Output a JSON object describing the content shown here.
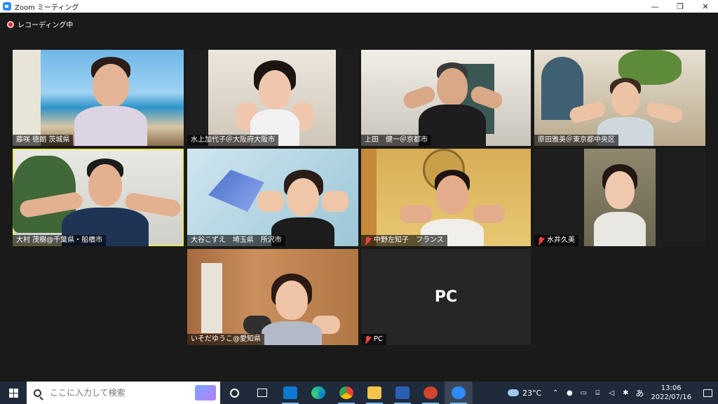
{
  "window": {
    "title": "Zoom ミーティング",
    "minimize": "—",
    "restore": "❐",
    "close": "✕"
  },
  "recording": {
    "label": "レコーディング中"
  },
  "tiles": [
    {
      "name": "藤咲 徳朗 茨城県",
      "muted": false,
      "active": false
    },
    {
      "name": "水上加代子＠大阪府大阪市",
      "muted": false,
      "active": false
    },
    {
      "name": "上田　健一＠京都市",
      "muted": false,
      "active": false
    },
    {
      "name": "原田雅美＠東京都中央区",
      "muted": false,
      "active": false
    },
    {
      "name": "大村 茂樹@千葉県・船橋市",
      "muted": false,
      "active": true
    },
    {
      "name": "大谷こずえ　埼玉県　所沢市",
      "muted": false,
      "active": false
    },
    {
      "name": "中野左知子　フランス",
      "muted": true,
      "active": false
    },
    {
      "name": "水井久美",
      "muted": true,
      "active": false
    },
    {
      "name": "いそだゆうこ@愛知県",
      "muted": false,
      "active": false
    },
    {
      "name": "PC",
      "muted": true,
      "active": false,
      "video_off_label": "PC"
    }
  ],
  "taskbar": {
    "search_placeholder": "ここに入力して検索",
    "apps": [
      "task-view",
      "mail",
      "edge",
      "chrome",
      "file-explorer",
      "word",
      "powerpoint",
      "zoom"
    ],
    "weather": "23°C",
    "ime": "あ",
    "time": "13:06",
    "date": "2022/07/16"
  },
  "colors": {
    "active_border": "#e6e858",
    "muted_mic": "#ff4444",
    "taskbar_bg": "#1f2a3a"
  }
}
